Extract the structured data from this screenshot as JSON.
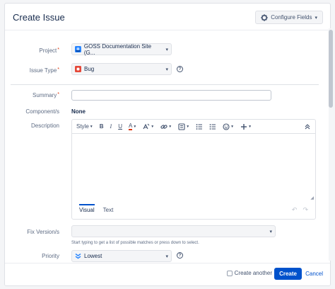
{
  "dialog": {
    "title": "Create Issue",
    "configure_fields": "Configure Fields",
    "configure_caret": "▾"
  },
  "fields": {
    "project": {
      "label": "Project",
      "value": "GOSS Documentation Site (G...",
      "icon": "project-avatar-icon"
    },
    "issue_type": {
      "label": "Issue Type",
      "value": "Bug",
      "icon": "bug-icon"
    },
    "summary": {
      "label": "Summary",
      "value": ""
    },
    "components": {
      "label": "Component/s",
      "value": "None"
    },
    "description": {
      "label": "Description",
      "toolbar": {
        "style": "Style",
        "bold": "B",
        "italic": "I",
        "underline": "U",
        "color": "A"
      },
      "tabs": [
        "Visual",
        "Text"
      ]
    },
    "fix_versions": {
      "label": "Fix Version/s",
      "value": "",
      "hint": "Start typing to get a list of possible matches or press down to select."
    },
    "priority": {
      "label": "Priority",
      "value": "Lowest",
      "icon": "lowest-priority-icon"
    }
  },
  "required_marker": "*",
  "footer": {
    "create_another": "Create another",
    "create": "Create",
    "cancel": "Cancel"
  },
  "colors": {
    "primary": "#0052cc",
    "required": "#de350b",
    "bug": "#e5493a",
    "priority": "#2684ff"
  }
}
